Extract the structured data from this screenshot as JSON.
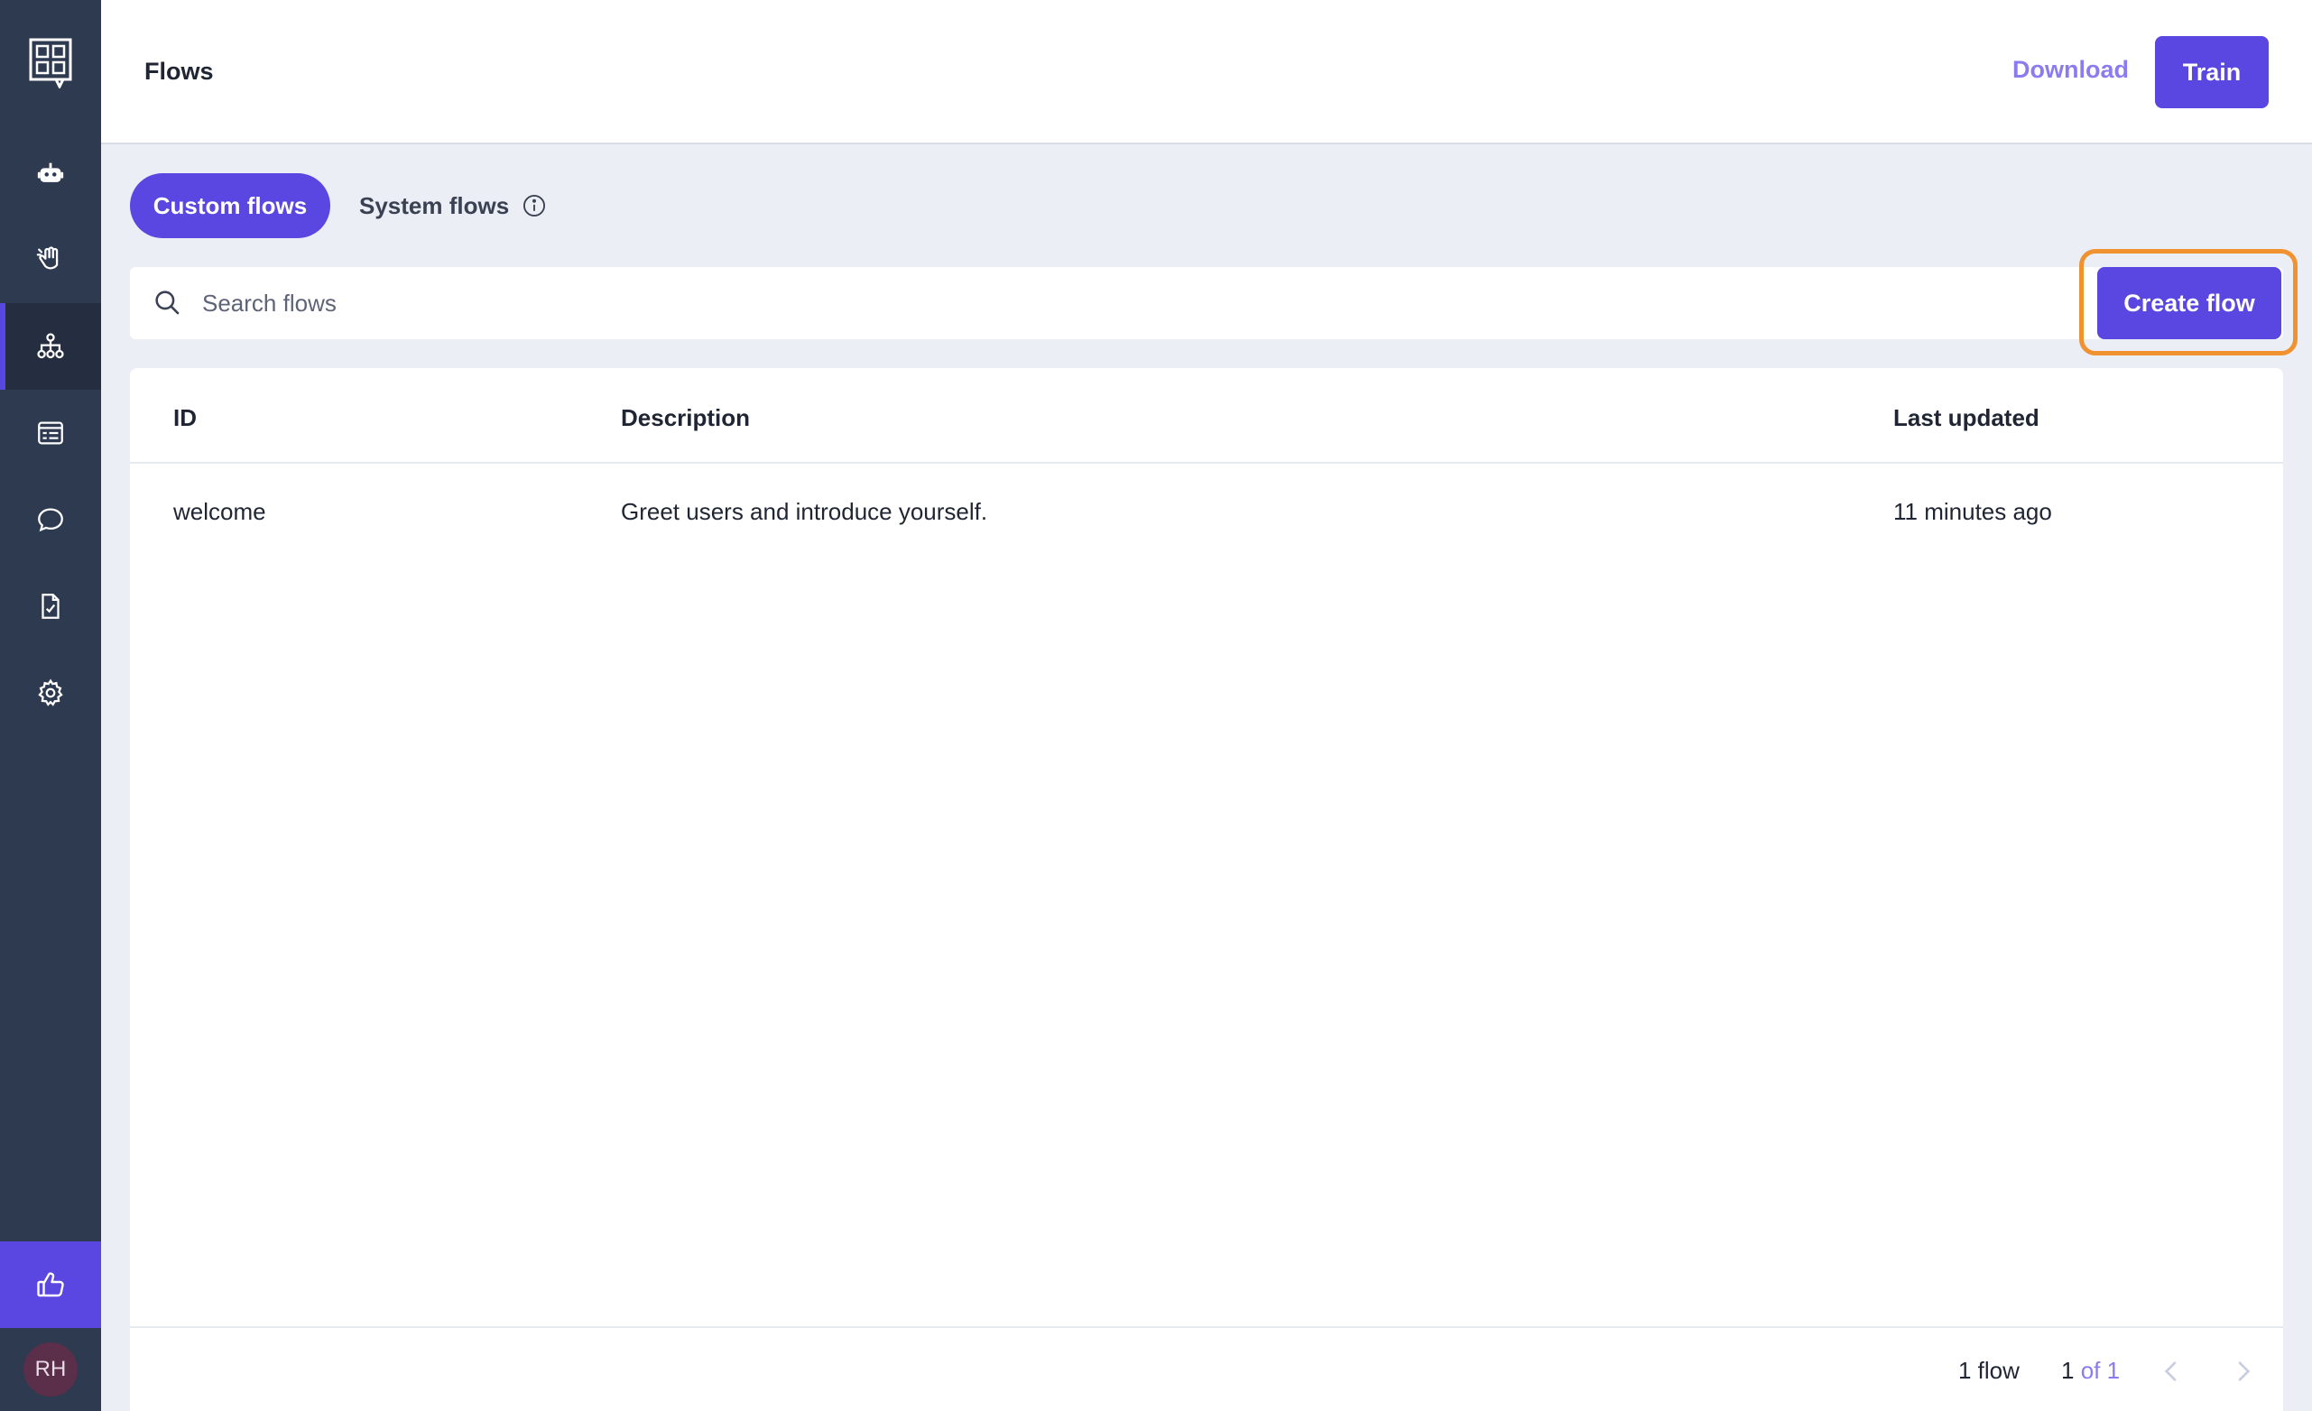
{
  "header": {
    "title": "Flows",
    "download_label": "Download",
    "train_label": "Train"
  },
  "sidebar": {
    "logo": "rasa-logo",
    "items": [
      {
        "icon": "robot-icon",
        "active": false
      },
      {
        "icon": "hand-wave-icon",
        "active": false
      },
      {
        "icon": "flows-hierarchy-icon",
        "active": true
      },
      {
        "icon": "responses-list-icon",
        "active": false
      },
      {
        "icon": "conversation-bubble-icon",
        "active": false
      },
      {
        "icon": "clipboard-check-icon",
        "active": false
      },
      {
        "icon": "gear-icon",
        "active": false
      }
    ],
    "feedback_icon": "thumbs-up-icon",
    "avatar_initials": "RH"
  },
  "tabs": {
    "custom_label": "Custom flows",
    "system_label": "System flows"
  },
  "search": {
    "placeholder": "Search flows",
    "value": ""
  },
  "create_label": "Create flow",
  "table": {
    "columns": [
      "ID",
      "Description",
      "Last updated"
    ],
    "rows": [
      {
        "id": "welcome",
        "description": "Greet users and introduce yourself.",
        "updated": "11 minutes ago"
      }
    ]
  },
  "footer": {
    "count": "1 flow",
    "page_current": "1",
    "page_of": "of 1"
  },
  "colors": {
    "accent": "#5a46e0",
    "sidebar": "#2e3a50",
    "highlight": "#f0922f",
    "background": "#ebeef5"
  }
}
